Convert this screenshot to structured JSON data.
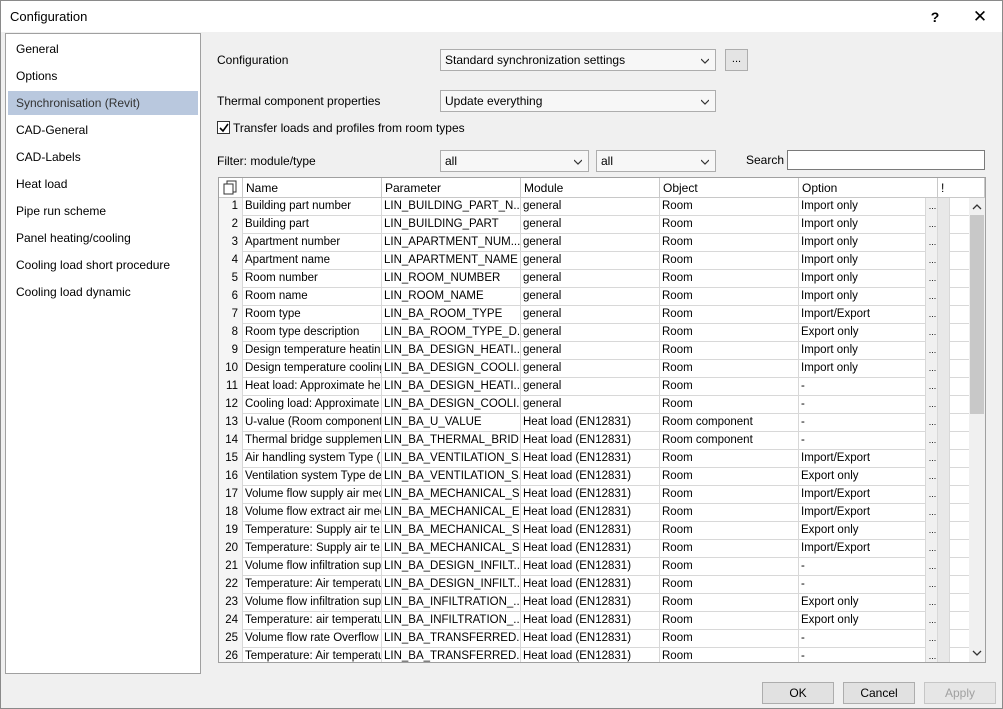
{
  "window": {
    "title": "Configuration",
    "help_glyph": "?",
    "close_glyph": "✕"
  },
  "sidebar": {
    "items": [
      {
        "label": "General"
      },
      {
        "label": "Options"
      },
      {
        "label": "Synchronisation (Revit)"
      },
      {
        "label": "CAD-General"
      },
      {
        "label": "CAD-Labels"
      },
      {
        "label": "Heat load"
      },
      {
        "label": "Pipe run scheme"
      },
      {
        "label": "Panel heating/cooling"
      },
      {
        "label": "Cooling load short procedure"
      },
      {
        "label": "Cooling load dynamic"
      }
    ],
    "selected_index": 2
  },
  "form": {
    "configuration_label": "Configuration",
    "configuration_value": "Standard synchronization settings",
    "more_button": "...",
    "thermal_label": "Thermal component properties",
    "thermal_value": "Update everything",
    "transfer_label": "Transfer loads and profiles from room types",
    "transfer_checked": true,
    "filter_label": "Filter: module/type",
    "filter_module_value": "all",
    "filter_type_value": "all",
    "search_label": "Search",
    "search_value": ""
  },
  "grid": {
    "columns": [
      "Name",
      "Parameter",
      "Module",
      "Object",
      "Option",
      "!"
    ],
    "rows": [
      [
        "1",
        "Building part number",
        "LIN_BUILDING_PART_N...",
        "general",
        "Room",
        "Import only"
      ],
      [
        "2",
        "Building part",
        "LIN_BUILDING_PART",
        "general",
        "Room",
        "Import only"
      ],
      [
        "3",
        "Apartment number",
        "LIN_APARTMENT_NUM...",
        "general",
        "Room",
        "Import only"
      ],
      [
        "4",
        "Apartment name",
        "LIN_APARTMENT_NAME",
        "general",
        "Room",
        "Import only"
      ],
      [
        "5",
        "Room number",
        "LIN_ROOM_NUMBER",
        "general",
        "Room",
        "Import only"
      ],
      [
        "6",
        "Room name",
        "LIN_ROOM_NAME",
        "general",
        "Room",
        "Import only"
      ],
      [
        "7",
        "Room type",
        "LIN_BA_ROOM_TYPE",
        "general",
        "Room",
        "Import/Export"
      ],
      [
        "8",
        "Room type description",
        "LIN_BA_ROOM_TYPE_D...",
        "general",
        "Room",
        "Export only"
      ],
      [
        "9",
        "Design temperature heating",
        "LIN_BA_DESIGN_HEATI...",
        "general",
        "Room",
        "Import only"
      ],
      [
        "10",
        "Design temperature cooling",
        "LIN_BA_DESIGN_COOLI...",
        "general",
        "Room",
        "Import only"
      ],
      [
        "11",
        "Heat load: Approximate he...",
        "LIN_BA_DESIGN_HEATI...",
        "general",
        "Room",
        "-"
      ],
      [
        "12",
        "Cooling load: Approximate ...",
        "LIN_BA_DESIGN_COOLI...",
        "general",
        "Room",
        "-"
      ],
      [
        "13",
        "U-value (Room component)",
        "LIN_BA_U_VALUE",
        "Heat load (EN12831)",
        "Room component",
        "-"
      ],
      [
        "14",
        "Thermal bridge supplement...",
        "LIN_BA_THERMAL_BRID...",
        "Heat load (EN12831)",
        "Room component",
        "-"
      ],
      [
        "15",
        "Air handling system Type (h...",
        "LIN_BA_VENTILATION_S...",
        "Heat load (EN12831)",
        "Room",
        "Import/Export"
      ],
      [
        "16",
        "Ventilation system Type de...",
        "LIN_BA_VENTILATION_S...",
        "Heat load (EN12831)",
        "Room",
        "Export only"
      ],
      [
        "17",
        "Volume flow supply air mec...",
        "LIN_BA_MECHANICAL_S...",
        "Heat load (EN12831)",
        "Room",
        "Import/Export"
      ],
      [
        "18",
        "Volume flow extract air mec...",
        "LIN_BA_MECHANICAL_E...",
        "Heat load (EN12831)",
        "Room",
        "Import/Export"
      ],
      [
        "19",
        "Temperature: Supply air te...",
        "LIN_BA_MECHANICAL_S...",
        "Heat load (EN12831)",
        "Room",
        "Export only"
      ],
      [
        "20",
        "Temperature: Supply air te...",
        "LIN_BA_MECHANICAL_S...",
        "Heat load (EN12831)",
        "Room",
        "Import/Export"
      ],
      [
        "21",
        "Volume flow infiltration sup...",
        "LIN_BA_DESIGN_INFILT...",
        "Heat load (EN12831)",
        "Room",
        "-"
      ],
      [
        "22",
        "Temperature: Air temperatu...",
        "LIN_BA_DESIGN_INFILT...",
        "Heat load (EN12831)",
        "Room",
        "-"
      ],
      [
        "23",
        "Volume flow infiltration sup...",
        "LIN_BA_INFILTRATION_...",
        "Heat load (EN12831)",
        "Room",
        "Export only"
      ],
      [
        "24",
        "Temperature: air temperatu...",
        "LIN_BA_INFILTRATION_...",
        "Heat load (EN12831)",
        "Room",
        "Export only"
      ],
      [
        "25",
        "Volume flow rate Overflow ...",
        "LIN_BA_TRANSFERRED...",
        "Heat load (EN12831)",
        "Room",
        "-"
      ],
      [
        "26",
        "Temperature: Air temperatu...",
        "LIN_BA_TRANSFERRED...",
        "Heat load (EN12831)",
        "Room",
        "-"
      ]
    ],
    "more_glyph": "..."
  },
  "buttons": {
    "ok": "OK",
    "cancel": "Cancel",
    "apply": "Apply"
  }
}
